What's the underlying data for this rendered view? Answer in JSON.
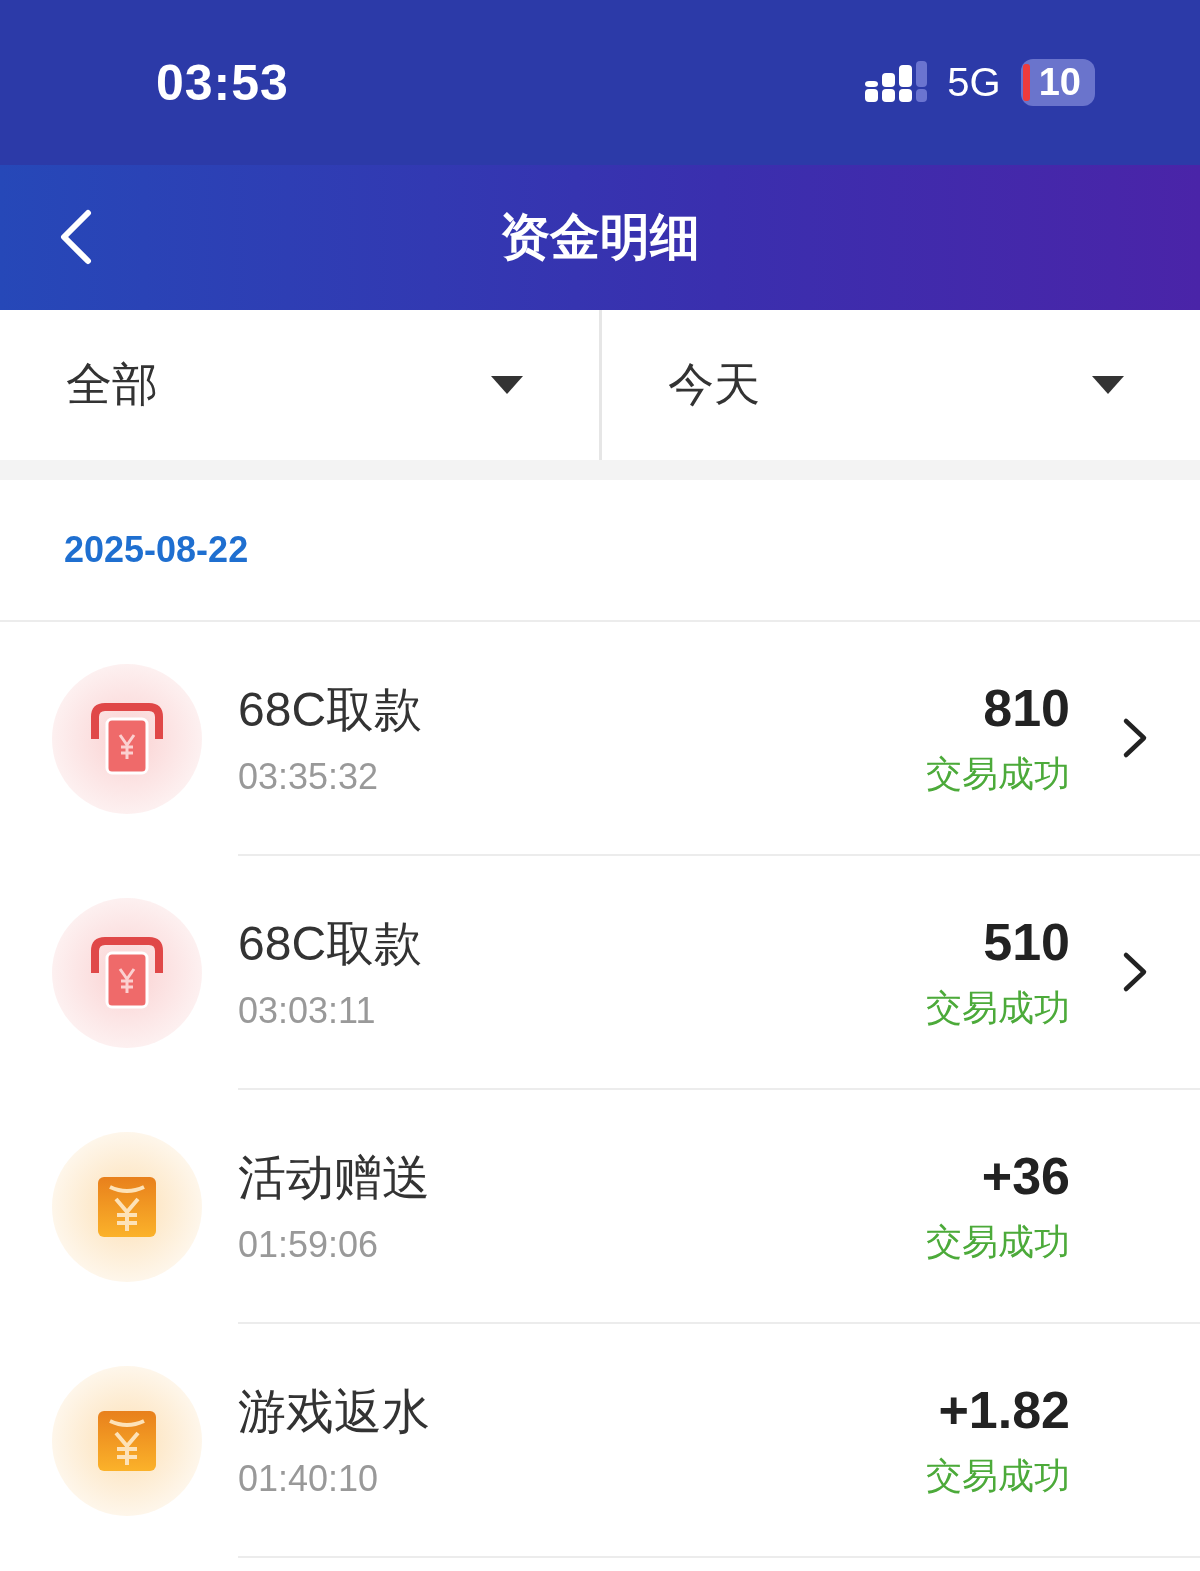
{
  "status_bar": {
    "time": "03:53",
    "network": "5G",
    "battery": "10"
  },
  "nav": {
    "title": "资金明细"
  },
  "filters": [
    {
      "label": "全部"
    },
    {
      "label": "今天"
    }
  ],
  "date": "2025-08-22",
  "transactions": [
    {
      "kind": "withdraw",
      "title": "68C取款",
      "time": "03:35:32",
      "amount": "810",
      "status": "交易成功",
      "has_detail": true
    },
    {
      "kind": "withdraw",
      "title": "68C取款",
      "time": "03:03:11",
      "amount": "510",
      "status": "交易成功",
      "has_detail": true
    },
    {
      "kind": "bonus",
      "title": "活动赠送",
      "time": "01:59:06",
      "amount": "+36",
      "status": "交易成功",
      "has_detail": false
    },
    {
      "kind": "bonus",
      "title": "游戏返水",
      "time": "01:40:10",
      "amount": "+1.82",
      "status": "交易成功",
      "has_detail": false
    }
  ]
}
